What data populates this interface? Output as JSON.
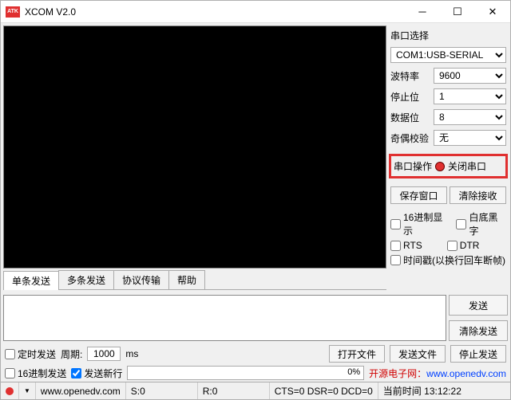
{
  "window": {
    "title": "XCOM V2.0",
    "logo": "ATK"
  },
  "sidebar": {
    "port_label": "串口选择",
    "port_value": "COM1:USB-SERIAL",
    "baud_label": "波特率",
    "baud_value": "9600",
    "stop_label": "停止位",
    "stop_value": "1",
    "data_label": "数据位",
    "data_value": "8",
    "parity_label": "奇偶校验",
    "parity_value": "无",
    "op_label": "串口操作",
    "op_button": "关闭串口",
    "save_window": "保存窗口",
    "clear_rx": "清除接收",
    "hex_show": "16进制显示",
    "white_black": "白底黑字",
    "rts": "RTS",
    "dtr": "DTR",
    "timestamp": "时间戳(以换行回车断帧)"
  },
  "tabs": {
    "single": "单条发送",
    "multi": "多条发送",
    "proto": "协议传输",
    "help": "帮助"
  },
  "send": {
    "send_btn": "发送",
    "clear_send": "清除发送"
  },
  "opts": {
    "timed_send": "定时发送",
    "period_label": "周期:",
    "period_value": "1000",
    "period_unit": "ms",
    "open_file": "打开文件",
    "send_file": "发送文件",
    "stop_send": "停止发送",
    "hex_send": "16进制发送",
    "send_newline": "发送新行",
    "progress": "0%"
  },
  "ad": {
    "text1": "开源电子网：",
    "link": "www.openedv.com"
  },
  "status": {
    "url": "www.openedv.com",
    "s": "S:0",
    "r": "R:0",
    "cts": "CTS=0 DSR=0 DCD=0",
    "time_label": "当前时间",
    "time": "13:12:22"
  }
}
